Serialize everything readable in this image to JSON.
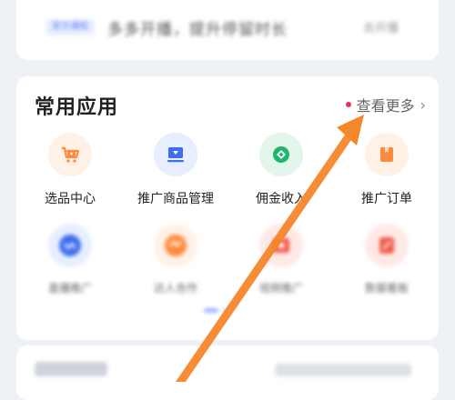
{
  "top_banner": {
    "tag": "官方通知",
    "text": "多多开播，提升停留时长",
    "right_link": "去开播"
  },
  "common_apps": {
    "title": "常用应用",
    "more_label": "查看更多",
    "items": [
      {
        "label": "选品中心",
        "icon": "shopping-cart-icon",
        "color": "#ff8a3d"
      },
      {
        "label": "推广商品管理",
        "icon": "monitor-icon",
        "color": "#3f6df0"
      },
      {
        "label": "佣金收入",
        "icon": "coin-icon",
        "color": "#1fb56b"
      },
      {
        "label": "推广订单",
        "icon": "order-icon",
        "color": "#ff8a3d"
      },
      {
        "label": "直播推广",
        "icon": "live-icon",
        "color": "#3f6df0"
      },
      {
        "label": "达人合作",
        "icon": "handshake-icon",
        "color": "#ff8a3d"
      },
      {
        "label": "视频推广",
        "icon": "video-icon",
        "color": "#f05a4a"
      },
      {
        "label": "数据看板",
        "icon": "edit-icon",
        "color": "#f05a4a"
      }
    ]
  },
  "colors": {
    "accent_orange": "#ff8a3d",
    "accent_blue": "#3f6df0",
    "accent_green": "#1fb56b",
    "accent_red": "#f05a4a",
    "annotation_arrow": "#f5862a"
  }
}
